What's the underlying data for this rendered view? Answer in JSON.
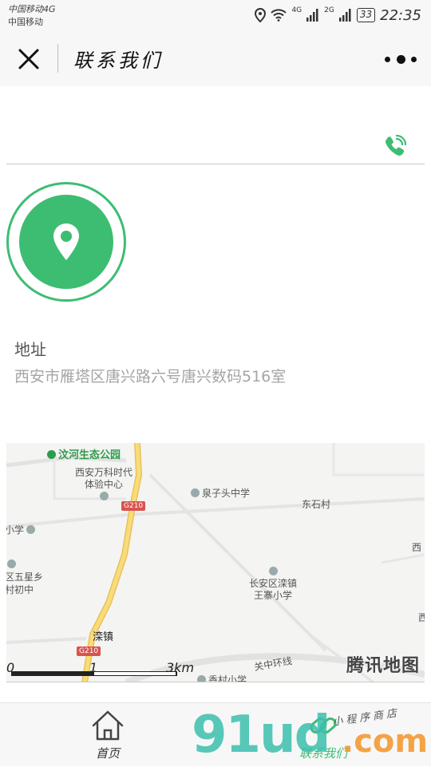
{
  "status_bar": {
    "carrier_line1": "中国移动4G",
    "carrier_line2": "中国移动",
    "net1": "4G",
    "net2": "2G",
    "battery": "33",
    "time": "22:35"
  },
  "nav": {
    "title": "联系我们",
    "close_icon": "close-icon",
    "more_icon": "more-dots-icon"
  },
  "phone": {
    "icon": "phone-icon",
    "color": "#3dbd72"
  },
  "location": {
    "icon": "location-pin-icon",
    "color": "#3dbd72"
  },
  "address": {
    "label": "地址",
    "text": "西安市雁塔区唐兴路六号唐兴数码516室"
  },
  "map": {
    "labels": {
      "park": "汶河生态公园",
      "vanke_l1": "西安万科时代",
      "vanke_l2": "体验中心",
      "road_g210_top": "G210",
      "quanzitou": "泉子头中学",
      "dongshi": "东石村",
      "left_xiao": "小学",
      "wuxing_l1": "区五星乡",
      "wuxing_l2": "村初中",
      "changan_l1": "长安区滦镇",
      "changan_l2": "王寨小学",
      "luanzhen": "滦镇",
      "road_g210_bottom": "G210",
      "guanzhong": "关中环线",
      "xiangcun": "香村小学",
      "right_xi": "西",
      "right_xi2": "西"
    },
    "scale": {
      "zero": "0",
      "one": "1",
      "three": "3km"
    },
    "logo": "腾讯地图"
  },
  "tabs": [
    {
      "label": "首页",
      "icon": "home-icon"
    },
    {
      "label": "联系我们",
      "icon": "link-icon"
    }
  ],
  "watermark": {
    "big": "91ud",
    "com": ".com",
    "sub": "小程序商店"
  }
}
